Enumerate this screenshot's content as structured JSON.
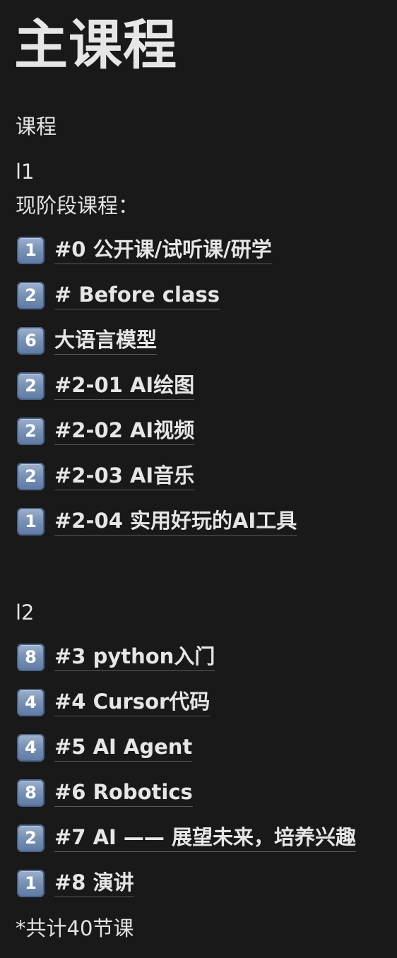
{
  "page": {
    "title": "主课程",
    "subtitle": "课程",
    "section_l1_label": "l1",
    "current_stage_label": "现阶段课程："
  },
  "l1_items": [
    {
      "count": "1",
      "label": "#0 公开课/试听课/研学"
    },
    {
      "count": "2",
      "label": "# Before class"
    },
    {
      "count": "6",
      "label": "大语言模型"
    },
    {
      "count": "2",
      "label": "#2-01 AI绘图"
    },
    {
      "count": "2",
      "label": "#2-02 AI视频"
    },
    {
      "count": "2",
      "label": "#2-03 AI音乐"
    },
    {
      "count": "1",
      "label": "#2-04 实用好玩的AI工具"
    }
  ],
  "section_l2_label": "l2",
  "l2_items": [
    {
      "count": "8",
      "label": "#3 python入门"
    },
    {
      "count": "4",
      "label": "#4 Cursor代码"
    },
    {
      "count": "4",
      "label": "#5 AI Agent"
    },
    {
      "count": "8",
      "label": "#6 Robotics"
    },
    {
      "count": "2",
      "label": "#7 AI —— 展望未来，培养兴趣"
    },
    {
      "count": "1",
      "label": "#8 演讲"
    }
  ],
  "footer_note": "*共计40节课",
  "colors": {
    "background": "#191919",
    "text": "#e3e3e3",
    "keycap": "#7a93b6",
    "link_underline": "#5a5a5a"
  }
}
